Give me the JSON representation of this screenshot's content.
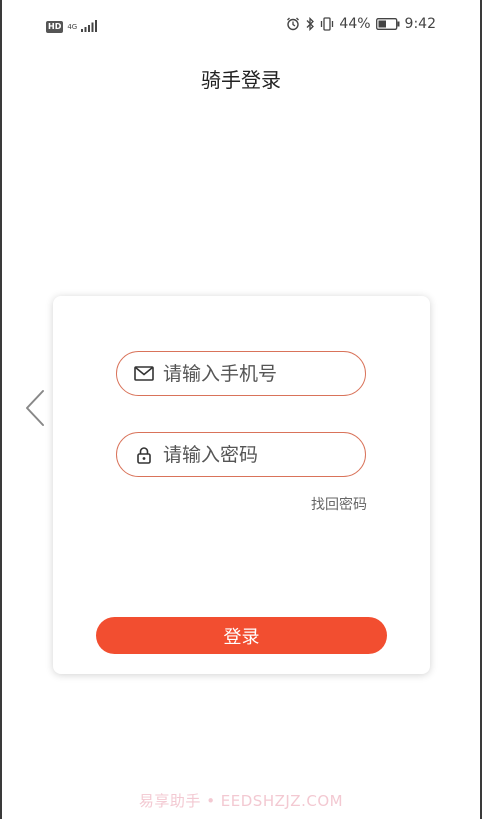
{
  "status_bar": {
    "hd_badge": "HD",
    "network_type": "4G",
    "battery_percent": "44%",
    "time": "9:42"
  },
  "header": {
    "title": "骑手登录"
  },
  "login_form": {
    "phone_placeholder": "请输入手机号",
    "password_placeholder": "请输入密码",
    "forgot_password": "找回密码",
    "login_button": "登录"
  },
  "watermark": "易享助手 • EEDSHZJZ.COM",
  "colors": {
    "accent": "#f24e30",
    "field_border": "#d9735a"
  },
  "icons": [
    "back-chevron-icon",
    "mail-icon",
    "lock-icon",
    "signal-icon",
    "alarm-icon",
    "bluetooth-icon",
    "vibrate-icon",
    "battery-icon"
  ]
}
